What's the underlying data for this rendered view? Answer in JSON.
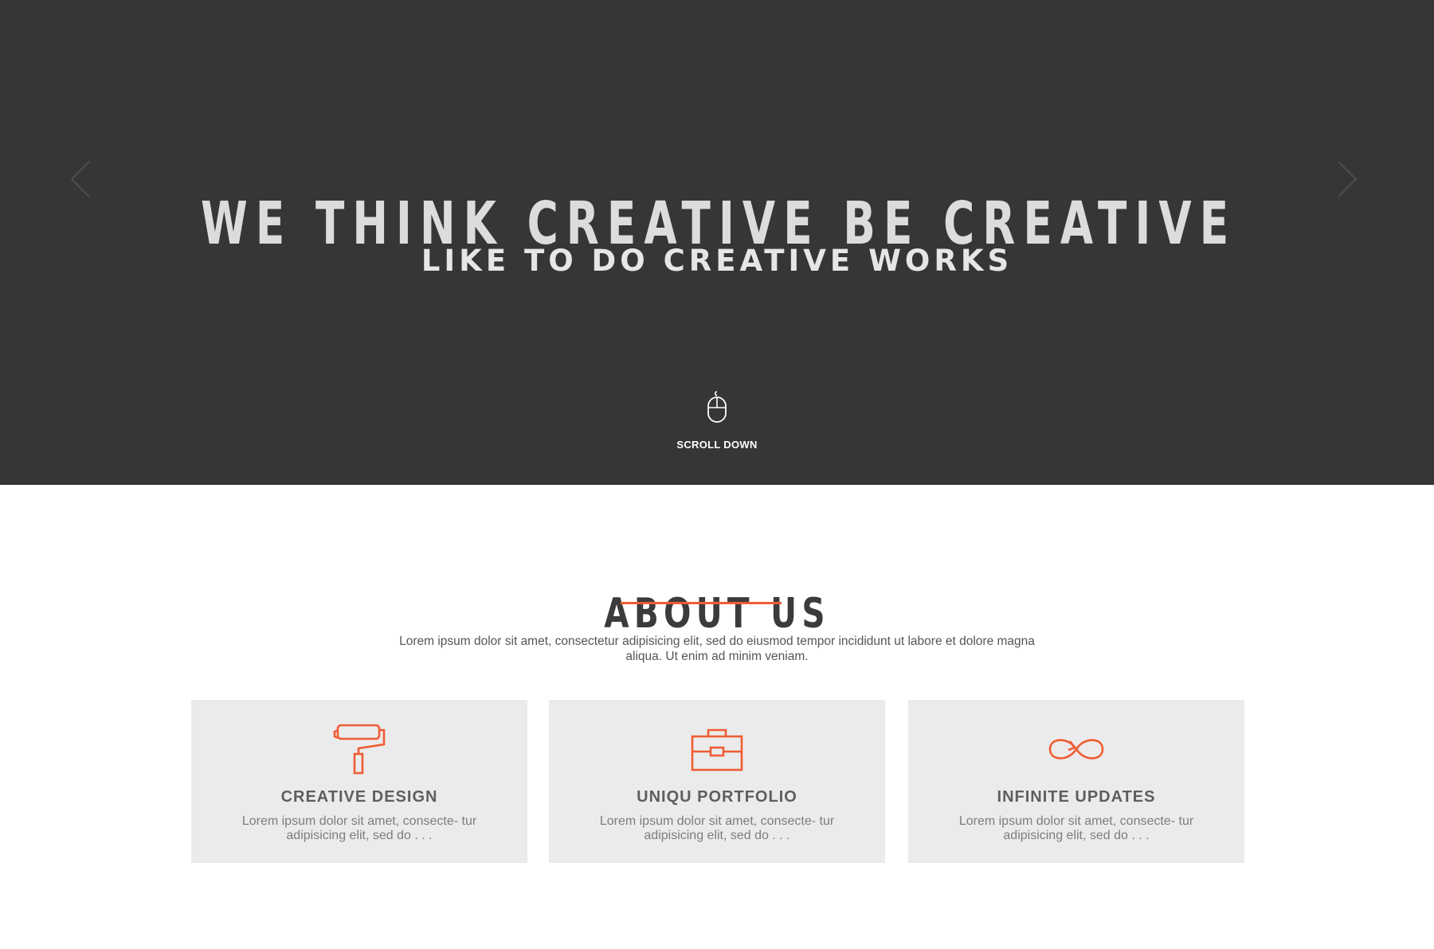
{
  "hero": {
    "title": "WE THINK CREATIVE BE CREATIVE",
    "subtitle": "LIKE TO DO CREATIVE WORKS",
    "prev_icon": "chevron-left-icon",
    "next_icon": "chevron-right-icon",
    "scroll_icon": "mouse-icon",
    "scroll_label": "SCROLL DOWN"
  },
  "about": {
    "title": "ABOUT US",
    "text": "Lorem ipsum dolor sit amet, consectetur adipisicing elit, sed do eiusmod tempor incididunt ut labore et dolore magna aliqua. Ut enim ad minim veniam."
  },
  "features": [
    {
      "icon": "paint-roller-icon",
      "title": "CREATIVE DESIGN",
      "description": "Lorem ipsum dolor sit amet, consecte- tur adipisicing elit, sed do . . ."
    },
    {
      "icon": "briefcase-icon",
      "title": "UNIQU PORTFOLIO",
      "description": "Lorem ipsum dolor sit amet, consecte- tur adipisicing elit, sed do . . ."
    },
    {
      "icon": "infinity-icon",
      "title": "INFINITE UPDATES",
      "description": "Lorem ipsum dolor sit amet, consecte- tur adipisicing elit, sed do . . ."
    }
  ],
  "colors": {
    "hero_background": "#363636",
    "accent": "#ef5d34",
    "card_background": "#ebebeb"
  }
}
